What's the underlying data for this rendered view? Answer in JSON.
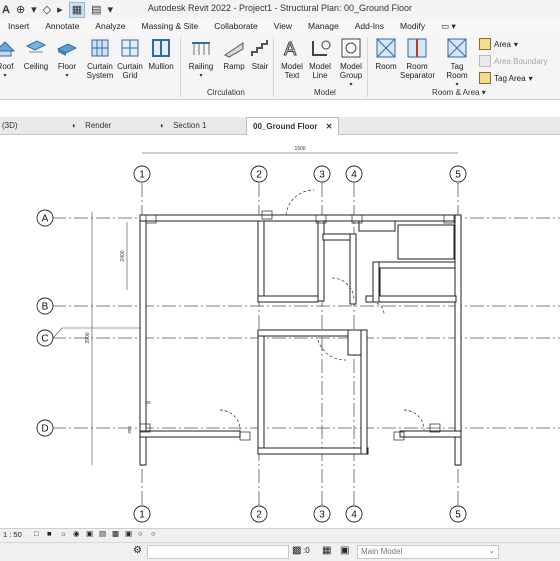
{
  "window": {
    "title": "Autodesk Revit 2022 - Project1 - Structural Plan: 00_Ground Floor"
  },
  "menu": {
    "tabs": [
      "Insert",
      "Annotate",
      "Analyze",
      "Massing & Site",
      "Collaborate",
      "View",
      "Manage",
      "Add-Ins",
      "Modify"
    ]
  },
  "ribbon": {
    "build": [
      "Roof",
      "Ceiling",
      "Floor",
      "Curtain System",
      "Curtain Grid",
      "Mullion"
    ],
    "circulation": {
      "label": "Circulation",
      "items": [
        "Railing",
        "Ramp",
        "Stair"
      ]
    },
    "model": {
      "label": "Model",
      "items": [
        "Model Text",
        "Model Line",
        "Model Group"
      ]
    },
    "room_area": {
      "label": "Room & Area",
      "items": [
        "Room",
        "Room Separator",
        "Tag Room"
      ],
      "small_items": [
        "Area",
        "Area Boundary",
        "Tag Area"
      ]
    }
  },
  "view_tabs": [
    {
      "label": "(3D)"
    },
    {
      "label": "Render"
    },
    {
      "label": "Section 1"
    },
    {
      "label": "00_Ground Floor",
      "active": true
    }
  ],
  "drawing": {
    "grid_columns": [
      "1",
      "2",
      "3",
      "4",
      "5"
    ],
    "grid_rows": [
      "A",
      "B",
      "C",
      "D"
    ],
    "dimensions": [
      "1500",
      "2400",
      "3900",
      "300",
      "300"
    ]
  },
  "view_controls": {
    "scale": "1 : 50"
  },
  "status": {
    "coord": ":0",
    "workset": "Main Model"
  },
  "colors": {
    "ribbon_bg": "#f5f5f5",
    "accent_blue": "#2e7cc4",
    "canvas_bg": "#ffffff"
  }
}
